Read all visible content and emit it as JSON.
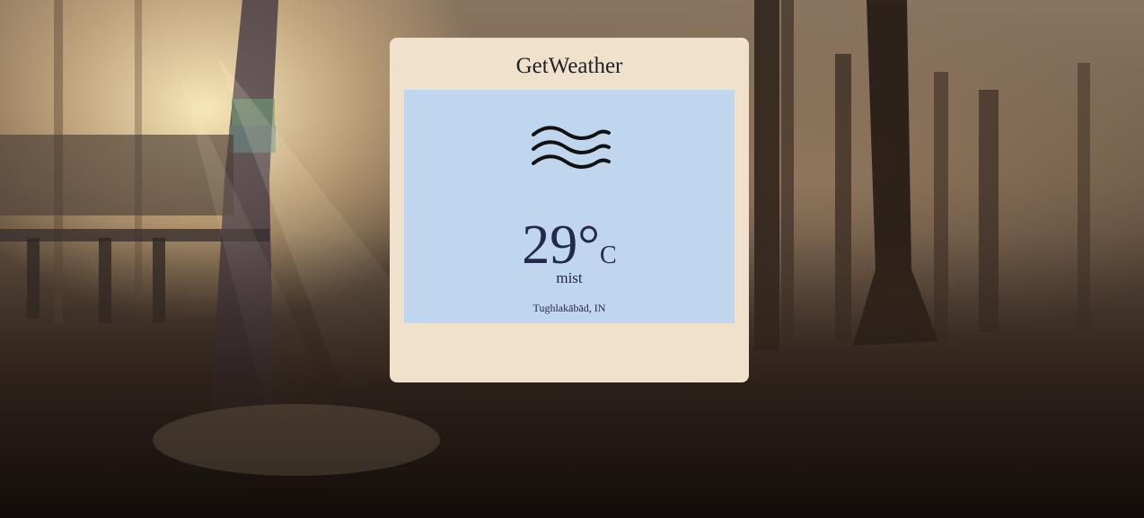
{
  "app": {
    "title": "GetWeather"
  },
  "weather": {
    "icon": "mist-icon",
    "temperature": "29°",
    "unit": "C",
    "description": "mist",
    "location": "Tughlakābād, IN"
  },
  "colors": {
    "card_background": "#efe1cb",
    "panel_background": "#c0d6ef",
    "text_dark": "#23284d"
  }
}
